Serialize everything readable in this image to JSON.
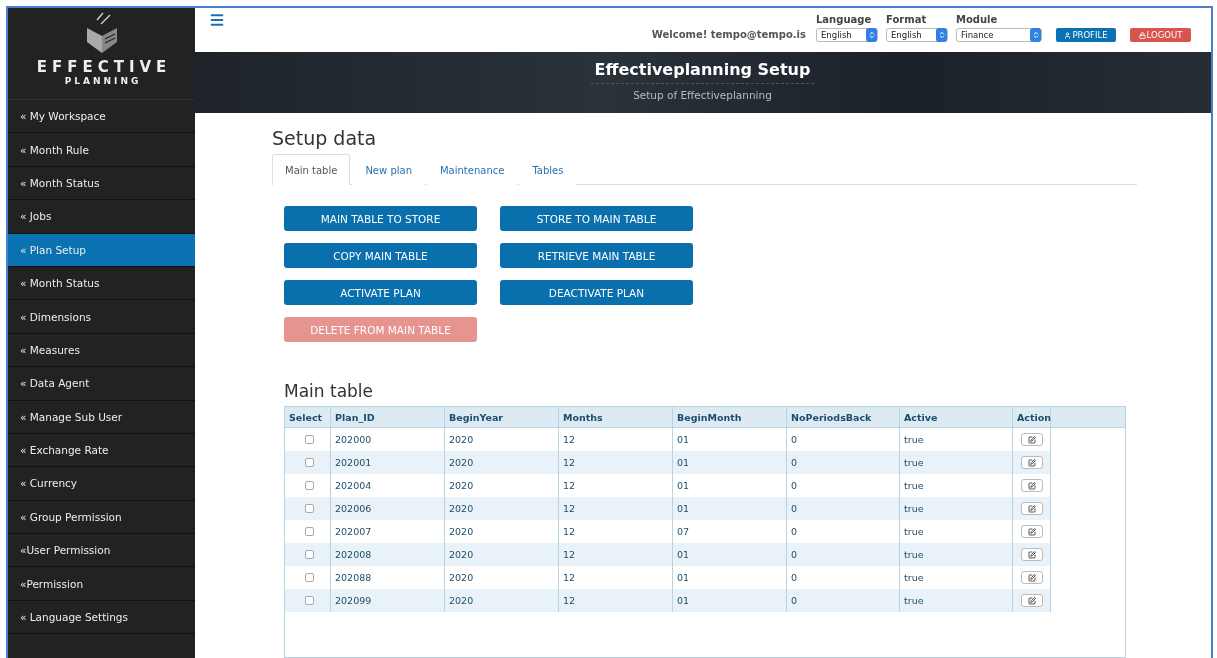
{
  "brand": {
    "name": "EFFECTIVE",
    "tagline": "PLANNING"
  },
  "sidebar": {
    "items": [
      {
        "label": "« My Workspace",
        "selected": false
      },
      {
        "label": "« Month Rule",
        "selected": false
      },
      {
        "label": "« Month Status",
        "selected": false
      },
      {
        "label": "« Jobs",
        "selected": false
      },
      {
        "label": "« Plan Setup",
        "selected": true
      },
      {
        "label": "« Month Status",
        "selected": false
      },
      {
        "label": "« Dimensions",
        "selected": false
      },
      {
        "label": "« Measures",
        "selected": false
      },
      {
        "label": "« Data Agent",
        "selected": false
      },
      {
        "label": "« Manage Sub User",
        "selected": false
      },
      {
        "label": "« Exchange Rate",
        "selected": false
      },
      {
        "label": "« Currency",
        "selected": false
      },
      {
        "label": "« Group Permission",
        "selected": false
      },
      {
        "label": "«User Permission",
        "selected": false
      },
      {
        "label": "«Permission",
        "selected": false
      },
      {
        "label": "« Language Settings",
        "selected": false
      }
    ]
  },
  "topbar": {
    "welcome": "Welcome! tempo@tempo.is",
    "selects": [
      {
        "label": "Language",
        "value": "English",
        "kind": "short"
      },
      {
        "label": "Format",
        "value": "English",
        "kind": "short"
      },
      {
        "label": "Module",
        "value": "Finance",
        "kind": "wide"
      }
    ],
    "buttons": [
      {
        "label": "PROFILE",
        "kind": "profile"
      },
      {
        "label": "LOGOUT",
        "kind": "logout"
      }
    ]
  },
  "banner": {
    "title": "Effectiveplanning Setup",
    "subtitle": "Setup of Effectiveplanning"
  },
  "page": {
    "title": "Setup data",
    "tabs": [
      {
        "label": "Main table",
        "selected": true
      },
      {
        "label": "New plan",
        "selected": false
      },
      {
        "label": "Maintenance",
        "selected": false
      },
      {
        "label": "Tables",
        "selected": false
      }
    ],
    "actions": [
      {
        "label": "MAIN TABLE TO STORE",
        "disabled": false
      },
      {
        "label": "STORE TO MAIN TABLE",
        "disabled": false
      },
      {
        "label": "COPY MAIN TABLE",
        "disabled": false
      },
      {
        "label": "RETRIEVE MAIN TABLE",
        "disabled": false
      },
      {
        "label": "ACTIVATE PLAN",
        "disabled": false
      },
      {
        "label": "DEACTIVATE PLAN",
        "disabled": false
      },
      {
        "label": "DELETE FROM MAIN TABLE",
        "disabled": true
      }
    ]
  },
  "table": {
    "title": "Main table",
    "select_column": "Select",
    "columns": [
      "Plan_ID",
      "BeginYear",
      "Months",
      "BeginMonth",
      "NoPeriodsBack",
      "Active"
    ],
    "action_column": "Action",
    "rows": [
      {
        "checked": false,
        "cells": [
          "202000",
          "2020",
          "12",
          "01",
          "0",
          "true"
        ]
      },
      {
        "checked": false,
        "cells": [
          "202001",
          "2020",
          "12",
          "01",
          "0",
          "true"
        ]
      },
      {
        "checked": false,
        "cells": [
          "202004",
          "2020",
          "12",
          "01",
          "0",
          "true"
        ]
      },
      {
        "checked": false,
        "cells": [
          "202006",
          "2020",
          "12",
          "01",
          "0",
          "true"
        ]
      },
      {
        "checked": false,
        "cells": [
          "202007",
          "2020",
          "12",
          "07",
          "0",
          "true"
        ]
      },
      {
        "checked": false,
        "cells": [
          "202008",
          "2020",
          "12",
          "01",
          "0",
          "true"
        ]
      },
      {
        "checked": false,
        "cells": [
          "202088",
          "2020",
          "12",
          "01",
          "0",
          "true"
        ]
      },
      {
        "checked": false,
        "cells": [
          "202099",
          "2020",
          "12",
          "01",
          "0",
          "true"
        ]
      }
    ]
  }
}
